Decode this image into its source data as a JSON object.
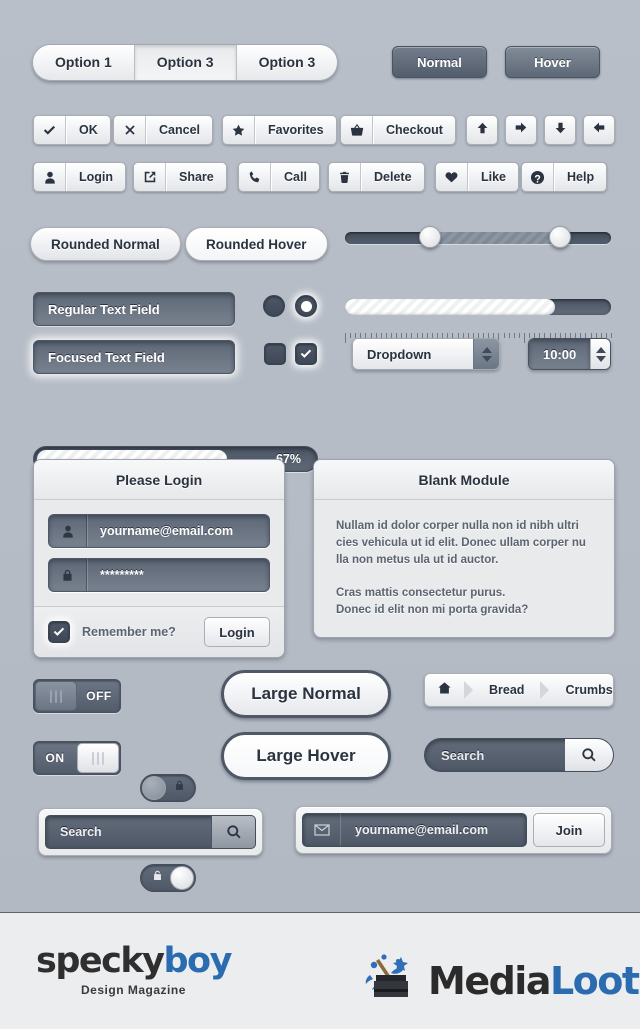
{
  "segmented": {
    "options": [
      {
        "label": "Option 1",
        "active": false
      },
      {
        "label": "Option 3",
        "active": true
      },
      {
        "label": "Option 3",
        "active": false
      }
    ]
  },
  "push_buttons": [
    {
      "label": "Normal",
      "state": "normal"
    },
    {
      "label": "Hover",
      "state": "hover"
    }
  ],
  "icon_buttons_row1": [
    {
      "label": "OK",
      "icon": "check-icon"
    },
    {
      "label": "Cancel",
      "icon": "close-icon"
    },
    {
      "label": "Favorites",
      "icon": "star-icon"
    },
    {
      "label": "Checkout",
      "icon": "basket-icon"
    }
  ],
  "arrow_buttons": [
    {
      "icon": "arrow-up-icon"
    },
    {
      "icon": "arrow-right-icon"
    },
    {
      "icon": "arrow-down-icon"
    },
    {
      "icon": "arrow-left-icon"
    }
  ],
  "icon_buttons_row2": [
    {
      "label": "Login",
      "icon": "user-icon"
    },
    {
      "label": "Share",
      "icon": "share-icon"
    },
    {
      "label": "Call",
      "icon": "phone-icon"
    },
    {
      "label": "Delete",
      "icon": "trash-icon"
    },
    {
      "label": "Like",
      "icon": "heart-icon"
    },
    {
      "label": "Help",
      "icon": "question-icon"
    }
  ],
  "rounded_buttons": [
    {
      "label": "Rounded Normal",
      "state": "normal"
    },
    {
      "label": "Rounded Hover",
      "state": "hover"
    }
  ],
  "range_slider": {
    "min_percent": 32,
    "max_percent": 81
  },
  "ruler_slider": {
    "value_percent": 79
  },
  "text_fields": [
    {
      "value": "Regular Text Field",
      "state": "normal"
    },
    {
      "value": "Focused Text Field",
      "state": "focused"
    }
  ],
  "radios": [
    {
      "checked": false,
      "name": "radio-off"
    },
    {
      "checked": true,
      "name": "radio-on"
    }
  ],
  "checkboxes": [
    {
      "checked": false,
      "name": "checkbox-off"
    },
    {
      "checked": true,
      "name": "checkbox-on"
    }
  ],
  "dropdown": {
    "value": "Dropdown"
  },
  "time_spinner": {
    "value": "10:00"
  },
  "progress_bars": [
    {
      "percent": 67,
      "label": "67%",
      "style": "light"
    },
    {
      "percent": 67,
      "label": "67%",
      "style": "dark"
    }
  ],
  "login_module": {
    "title": "Please Login",
    "email_value": "yourname@email.com",
    "email_icon": "user-icon",
    "password_value": "*********",
    "password_icon": "lock-icon",
    "remember_label": "Remember me?",
    "remember_checked": true,
    "submit_label": "Login"
  },
  "blank_module": {
    "title": "Blank Module",
    "paragraph1": "Nullam id dolor corper nulla non id nibh ultri cies vehicula ut id elit. Donec ullam corper nu lla non metus ula ut id auctor.",
    "paragraph2": "Cras mattis consectetur purus.",
    "paragraph3": "Donec id elit non mi porta gravida?"
  },
  "toggles": [
    {
      "label": "OFF",
      "state": "off",
      "handle": "left"
    },
    {
      "label": "ON",
      "state": "on",
      "handle": "right"
    }
  ],
  "lock_pills": [
    {
      "icon": "lock-closed-icon",
      "state": "off"
    },
    {
      "icon": "lock-open-icon",
      "state": "on"
    }
  ],
  "large_buttons": [
    {
      "label": "Large Normal",
      "state": "normal"
    },
    {
      "label": "Large Hover",
      "state": "hover"
    }
  ],
  "breadcrumb": {
    "home_icon": "home-icon",
    "items": [
      "Bread",
      "Crumbs"
    ]
  },
  "search_pill": {
    "placeholder": "Search",
    "icon": "search-icon"
  },
  "search_boxed": {
    "placeholder": "Search",
    "icon": "search-icon"
  },
  "newsletter": {
    "icon": "mail-icon",
    "value": "yourname@email.com",
    "button_label": "Join"
  },
  "footer": {
    "logo1": {
      "part1": "specky",
      "part2": "boy",
      "tagline": "Design Magazine"
    },
    "logo2": {
      "part1": "Media",
      "part2": "Loot",
      "icon": "treasure-chest-icon"
    }
  },
  "colors": {
    "background": "#b7bdc6",
    "dark_control": "#56606f",
    "accent_blue": "#2b6cb0",
    "text_dark": "#2b3340",
    "footer_bg": "#ecedef"
  }
}
